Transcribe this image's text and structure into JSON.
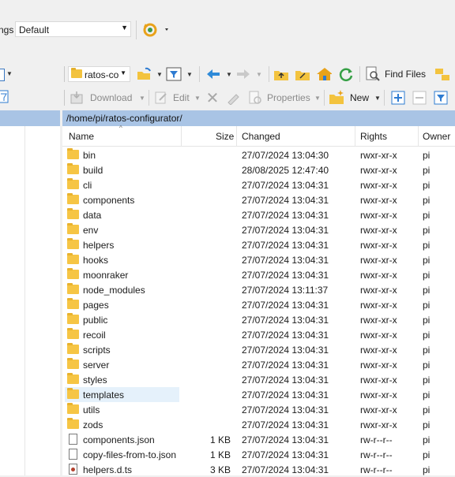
{
  "transfer": {
    "label_partial": "ngs",
    "value": "Default"
  },
  "toolbar": {
    "path_combo": "ratos-co",
    "find_files": "Find Files",
    "download": "Download",
    "edit": "Edit",
    "properties": "Properties",
    "new": "New"
  },
  "path": "/home/pi/ratos-configurator/",
  "columns": {
    "name": "Name",
    "size": "Size",
    "changed": "Changed",
    "rights": "Rights",
    "owner": "Owner"
  },
  "files": [
    {
      "name": "bin",
      "type": "folder",
      "size": "",
      "changed": "27/07/2024 13:04:30",
      "rights": "rwxr-xr-x",
      "owner": "pi"
    },
    {
      "name": "build",
      "type": "folder",
      "size": "",
      "changed": "28/08/2025 12:47:40",
      "rights": "rwxr-xr-x",
      "owner": "pi"
    },
    {
      "name": "cli",
      "type": "folder",
      "size": "",
      "changed": "27/07/2024 13:04:31",
      "rights": "rwxr-xr-x",
      "owner": "pi"
    },
    {
      "name": "components",
      "type": "folder",
      "size": "",
      "changed": "27/07/2024 13:04:31",
      "rights": "rwxr-xr-x",
      "owner": "pi"
    },
    {
      "name": "data",
      "type": "folder",
      "size": "",
      "changed": "27/07/2024 13:04:31",
      "rights": "rwxr-xr-x",
      "owner": "pi"
    },
    {
      "name": "env",
      "type": "folder",
      "size": "",
      "changed": "27/07/2024 13:04:31",
      "rights": "rwxr-xr-x",
      "owner": "pi"
    },
    {
      "name": "helpers",
      "type": "folder",
      "size": "",
      "changed": "27/07/2024 13:04:31",
      "rights": "rwxr-xr-x",
      "owner": "pi"
    },
    {
      "name": "hooks",
      "type": "folder",
      "size": "",
      "changed": "27/07/2024 13:04:31",
      "rights": "rwxr-xr-x",
      "owner": "pi"
    },
    {
      "name": "moonraker",
      "type": "folder",
      "size": "",
      "changed": "27/07/2024 13:04:31",
      "rights": "rwxr-xr-x",
      "owner": "pi"
    },
    {
      "name": "node_modules",
      "type": "folder",
      "size": "",
      "changed": "27/07/2024 13:11:37",
      "rights": "rwxr-xr-x",
      "owner": "pi"
    },
    {
      "name": "pages",
      "type": "folder",
      "size": "",
      "changed": "27/07/2024 13:04:31",
      "rights": "rwxr-xr-x",
      "owner": "pi"
    },
    {
      "name": "public",
      "type": "folder",
      "size": "",
      "changed": "27/07/2024 13:04:31",
      "rights": "rwxr-xr-x",
      "owner": "pi"
    },
    {
      "name": "recoil",
      "type": "folder",
      "size": "",
      "changed": "27/07/2024 13:04:31",
      "rights": "rwxr-xr-x",
      "owner": "pi"
    },
    {
      "name": "scripts",
      "type": "folder",
      "size": "",
      "changed": "27/07/2024 13:04:31",
      "rights": "rwxr-xr-x",
      "owner": "pi"
    },
    {
      "name": "server",
      "type": "folder",
      "size": "",
      "changed": "27/07/2024 13:04:31",
      "rights": "rwxr-xr-x",
      "owner": "pi"
    },
    {
      "name": "styles",
      "type": "folder",
      "size": "",
      "changed": "27/07/2024 13:04:31",
      "rights": "rwxr-xr-x",
      "owner": "pi"
    },
    {
      "name": "templates",
      "type": "folder",
      "size": "",
      "changed": "27/07/2024 13:04:31",
      "rights": "rwxr-xr-x",
      "owner": "pi",
      "selected": true
    },
    {
      "name": "utils",
      "type": "folder",
      "size": "",
      "changed": "27/07/2024 13:04:31",
      "rights": "rwxr-xr-x",
      "owner": "pi"
    },
    {
      "name": "zods",
      "type": "folder",
      "size": "",
      "changed": "27/07/2024 13:04:31",
      "rights": "rwxr-xr-x",
      "owner": "pi"
    },
    {
      "name": "components.json",
      "type": "file",
      "size": "1 KB",
      "changed": "27/07/2024 13:04:31",
      "rights": "rw-r--r--",
      "owner": "pi"
    },
    {
      "name": "copy-files-from-to.json",
      "type": "file",
      "size": "1 KB",
      "changed": "27/07/2024 13:04:31",
      "rights": "rw-r--r--",
      "owner": "pi"
    },
    {
      "name": "helpers.d.ts",
      "type": "ts",
      "size": "3 KB",
      "changed": "27/07/2024 13:04:31",
      "rights": "rw-r--r--",
      "owner": "pi"
    }
  ]
}
